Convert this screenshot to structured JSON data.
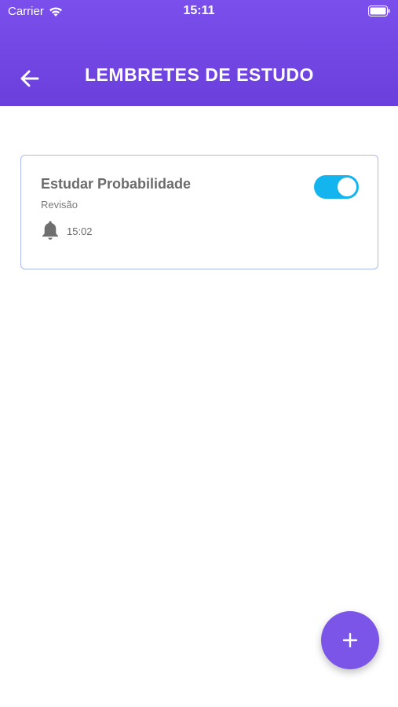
{
  "status_bar": {
    "carrier": "Carrier",
    "time": "15:11"
  },
  "header": {
    "title": "LEMBRETES DE ESTUDO",
    "back_icon": "arrow-left-icon",
    "background": "#7a4fec"
  },
  "reminders": [
    {
      "title": "Estudar Probabilidade",
      "subtitle": "Revisão",
      "time": "15:02",
      "enabled": true,
      "icon": "bell-icon"
    }
  ],
  "fab": {
    "icon": "plus-icon",
    "color": "#7b55e8"
  },
  "colors": {
    "accent": "#7b55e8",
    "toggle_on": "#14b4ef",
    "card_border": "#aab8ee"
  }
}
